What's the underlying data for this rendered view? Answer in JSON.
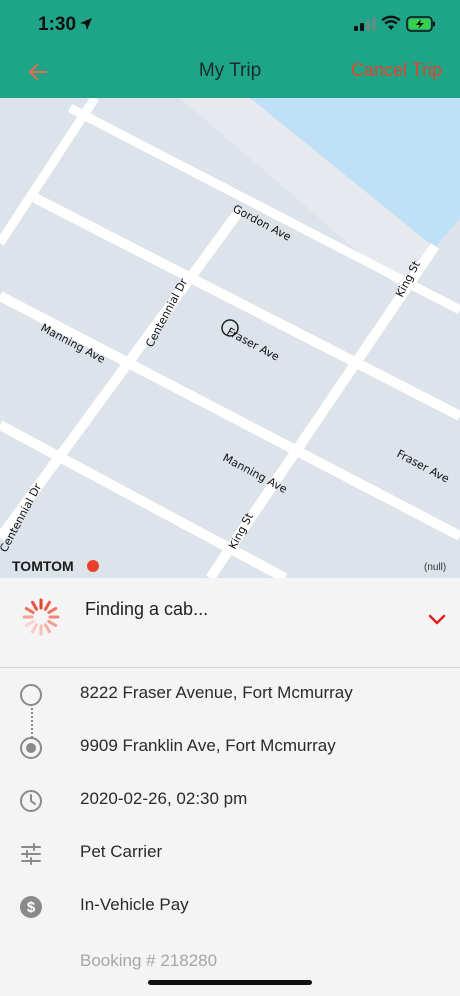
{
  "status_bar": {
    "time": "1:30"
  },
  "nav": {
    "title": "My Trip",
    "cancel_label": "Cancel Trip",
    "back_icon": "arrow-left-icon"
  },
  "map": {
    "streets": [
      "Gordon Ave",
      "King St",
      "Centennial Dr",
      "Fraser Ave",
      "Manning Ave",
      "Manning Ave",
      "Fraser Ave",
      "King St",
      "Centennial Dr"
    ],
    "logo": "TOMTOM",
    "null_label": "(null)"
  },
  "trip_status": {
    "text": "Finding a cab..."
  },
  "trip": {
    "pickup": "8222 Fraser Avenue, Fort Mcmurray",
    "dropoff": "9909 Franklin Ave, Fort Mcmurray",
    "datetime": "2020-02-26, 02:30 pm",
    "extras": "Pet Carrier",
    "payment": "In-Vehicle Pay",
    "booking": "Booking # 218280"
  },
  "colors": {
    "header": "#1ea587",
    "accent_red": "#e8412b",
    "map_bg": "#dde3ea",
    "water": "#bfe0f6"
  }
}
